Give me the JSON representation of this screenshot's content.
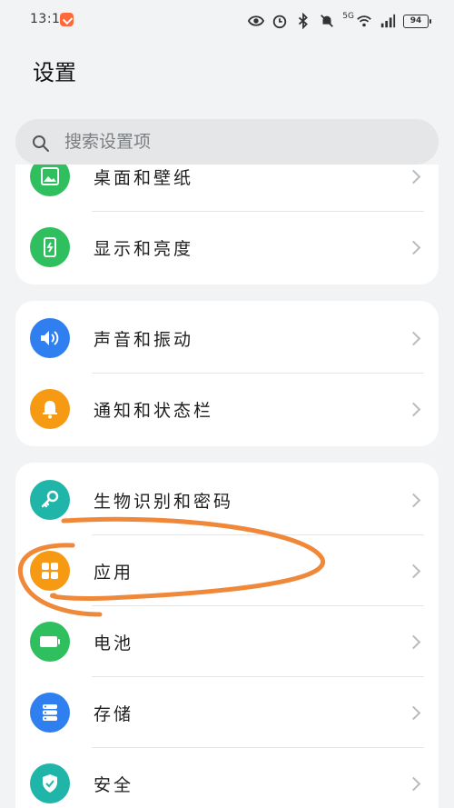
{
  "status_bar": {
    "time": "13:14",
    "battery": "94",
    "network": "5G",
    "icons": [
      "eye-icon",
      "alarm-icon",
      "bluetooth-icon",
      "mute-icon",
      "wifi-icon",
      "signal-icon",
      "battery-icon"
    ]
  },
  "page": {
    "title": "设置"
  },
  "search": {
    "placeholder": "搜索设置项"
  },
  "groups": [
    {
      "items": [
        {
          "label": "桌面和壁纸",
          "icon": "wallpaper-icon",
          "color": "#2fbf5f"
        },
        {
          "label": "显示和亮度",
          "icon": "display-icon",
          "color": "#2fbf5f"
        }
      ]
    },
    {
      "items": [
        {
          "label": "声音和振动",
          "icon": "sound-icon",
          "color": "#2f7ff0"
        },
        {
          "label": "通知和状态栏",
          "icon": "bell-icon",
          "color": "#f59a12"
        }
      ]
    },
    {
      "items": [
        {
          "label": "生物识别和密码",
          "icon": "key-icon",
          "color": "#1fb5a8"
        },
        {
          "label": "应用",
          "icon": "apps-icon",
          "color": "#f59a12"
        },
        {
          "label": "电池",
          "icon": "battery-icon",
          "color": "#2fbf5f"
        },
        {
          "label": "存储",
          "icon": "storage-icon",
          "color": "#2f7ff0"
        },
        {
          "label": "安全",
          "icon": "shield-icon",
          "color": "#1fb5a8"
        }
      ]
    }
  ],
  "annotation_color": "#f0883a"
}
